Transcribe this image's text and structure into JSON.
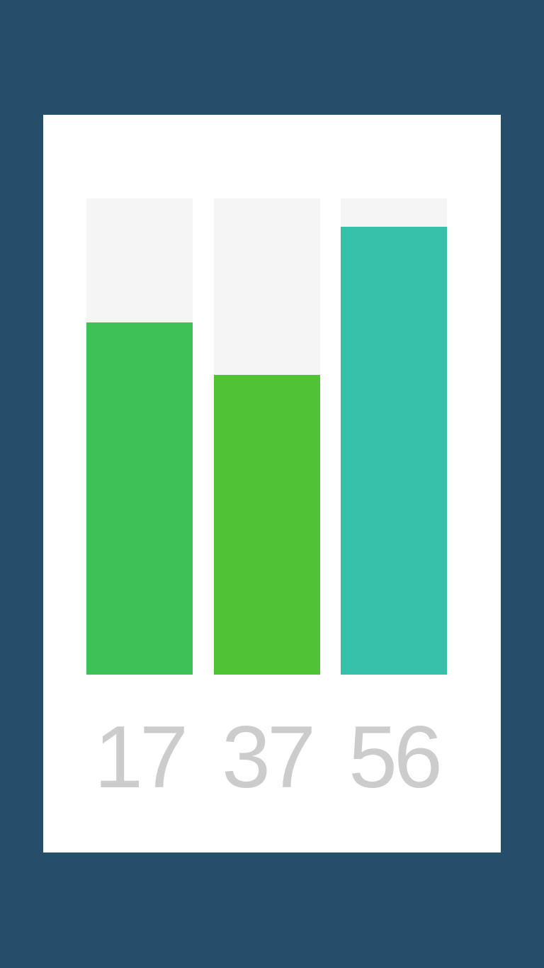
{
  "chart_data": {
    "type": "bar",
    "categories": [
      "17",
      "37",
      "56"
    ],
    "values": [
      74,
      63,
      94
    ],
    "ylim": [
      0,
      100
    ],
    "colors": [
      "#3ec257",
      "#50c235",
      "#37c1aa"
    ],
    "track_color": "#f5f5f5",
    "background_color": "#254e6b",
    "card_color": "#ffffff",
    "label_color": "#cccccc"
  }
}
